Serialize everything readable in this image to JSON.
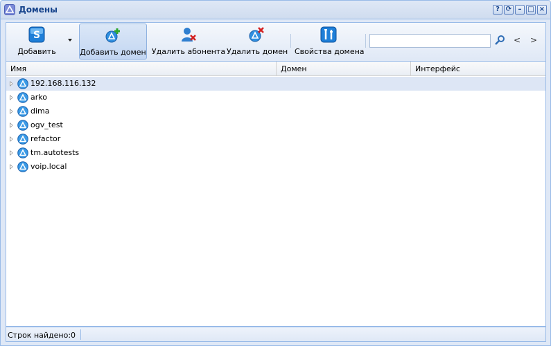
{
  "window": {
    "title": "Домены",
    "tools": [
      "?",
      "⟳",
      "–",
      "□",
      "×"
    ]
  },
  "toolbar": {
    "add_label": "Добавить",
    "add_domain_label": "Добавить домен",
    "delete_subscriber_label": "Удалить абонента",
    "delete_domain_label": "Удалить домен",
    "domain_properties_label": "Свойства домена",
    "search_placeholder": "",
    "prev": "<",
    "next": ">"
  },
  "grid": {
    "columns": [
      "Имя",
      "Домен",
      "Интерфейс"
    ],
    "rows": [
      {
        "name": "192.168.116.132",
        "selected": true
      },
      {
        "name": "arko"
      },
      {
        "name": "dima"
      },
      {
        "name": "ogv_test"
      },
      {
        "name": "refactor"
      },
      {
        "name": "tm.autotests"
      },
      {
        "name": "voip.local"
      }
    ]
  },
  "status": {
    "rows_found_label": "Строк найдено:",
    "rows_found_value": "0"
  },
  "colors": {
    "accent": "#15428b",
    "frame": "#99bbe8",
    "selected_row": "#dde6f5"
  }
}
